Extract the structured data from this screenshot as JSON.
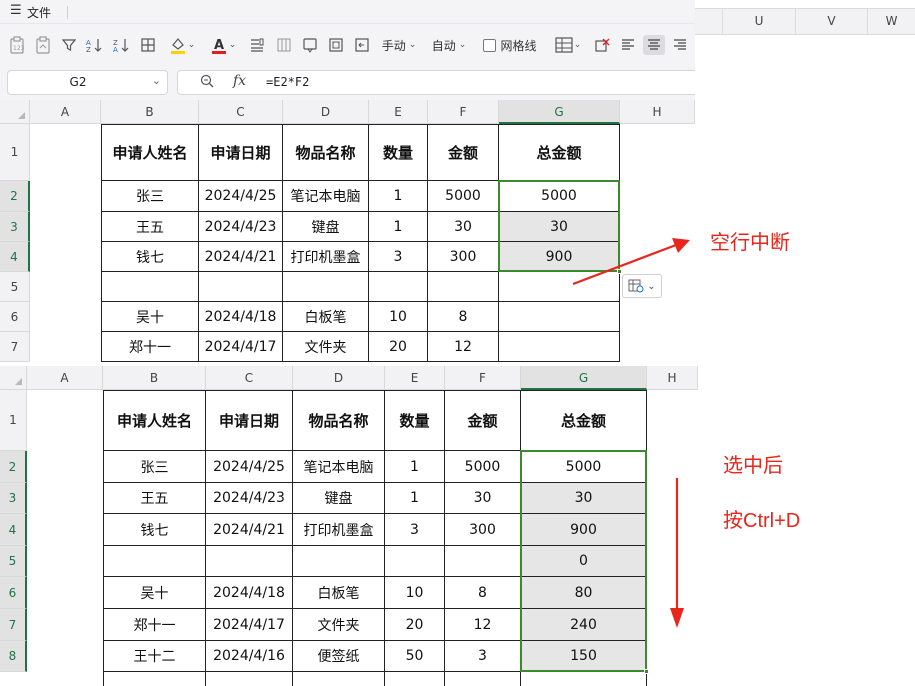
{
  "menu": {
    "file_label": "文件"
  },
  "toolbar": {
    "wrap_mode_label": "手动",
    "auto_label": "自动",
    "gridlines_label": "网格线",
    "font_color": "#e02020",
    "fill_color": "#f7d300"
  },
  "name_box": {
    "value": "G2"
  },
  "formula_bar": {
    "formula": "=E2*F2"
  },
  "right_columns": [
    "U",
    "V",
    "W"
  ],
  "grid_top": {
    "columns": [
      "A",
      "B",
      "C",
      "D",
      "E",
      "F",
      "G",
      "H"
    ],
    "rows": [
      "1",
      "2",
      "3",
      "4",
      "5",
      "6",
      "7"
    ],
    "headers": [
      "申请人姓名",
      "申请日期",
      "物品名称",
      "数量",
      "金额",
      "总金额"
    ],
    "data": [
      [
        "张三",
        "2024/4/25",
        "笔记本电脑",
        "1",
        "5000",
        "5000"
      ],
      [
        "王五",
        "2024/4/23",
        "键盘",
        "1",
        "30",
        "30"
      ],
      [
        "钱七",
        "2024/4/21",
        "打印机墨盒",
        "3",
        "300",
        "900"
      ],
      [
        "",
        "",
        "",
        "",
        "",
        ""
      ],
      [
        "吴十",
        "2024/4/18",
        "白板笔",
        "10",
        "8",
        ""
      ],
      [
        "郑十一",
        "2024/4/17",
        "文件夹",
        "20",
        "12",
        ""
      ]
    ]
  },
  "grid_bottom": {
    "columns": [
      "A",
      "B",
      "C",
      "D",
      "E",
      "F",
      "G",
      "H"
    ],
    "rows": [
      "1",
      "2",
      "3",
      "4",
      "5",
      "6",
      "7",
      "8"
    ],
    "headers": [
      "申请人姓名",
      "申请日期",
      "物品名称",
      "数量",
      "金额",
      "总金额"
    ],
    "data": [
      [
        "张三",
        "2024/4/25",
        "笔记本电脑",
        "1",
        "5000",
        "5000"
      ],
      [
        "王五",
        "2024/4/23",
        "键盘",
        "1",
        "30",
        "30"
      ],
      [
        "钱七",
        "2024/4/21",
        "打印机墨盒",
        "3",
        "300",
        "900"
      ],
      [
        "",
        "",
        "",
        "",
        "",
        "0"
      ],
      [
        "吴十",
        "2024/4/18",
        "白板笔",
        "10",
        "8",
        "80"
      ],
      [
        "郑十一",
        "2024/4/17",
        "文件夹",
        "20",
        "12",
        "240"
      ],
      [
        "王十二",
        "2024/4/16",
        "便签纸",
        "50",
        "3",
        "150"
      ]
    ]
  },
  "annotations": {
    "blank_row_break": "空行中断",
    "after_select": "选中后",
    "press_ctrl_d": "按Ctrl+D",
    "color": "#e8261b"
  }
}
